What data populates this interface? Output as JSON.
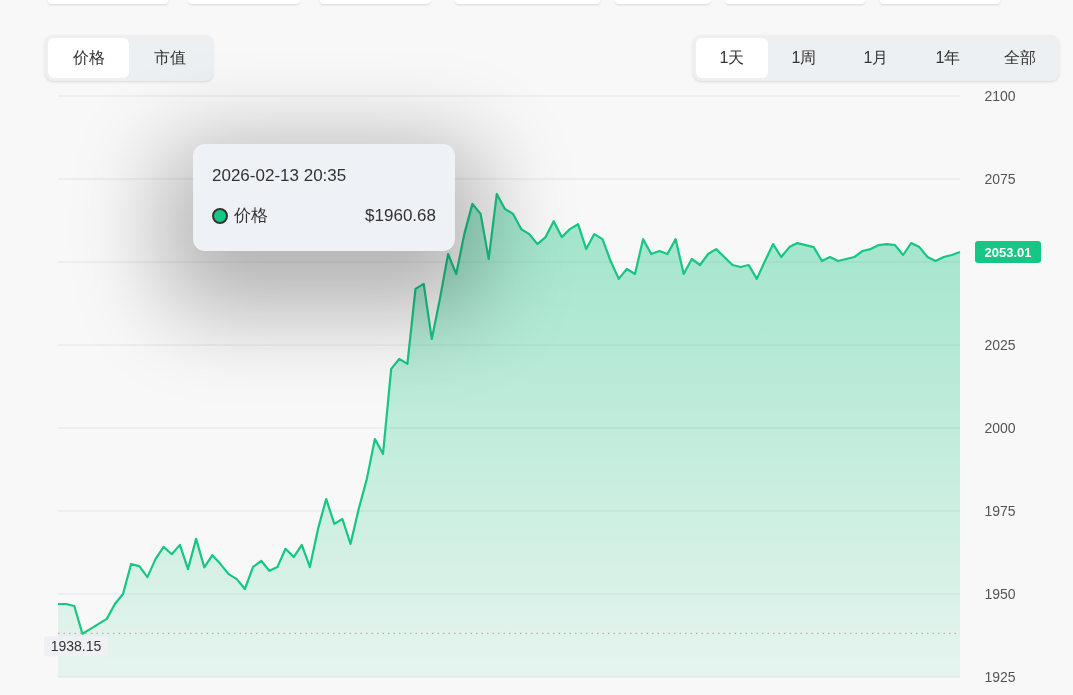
{
  "metric_tabs": [
    {
      "label": "价格",
      "selected": true
    },
    {
      "label": "市值",
      "selected": false
    }
  ],
  "range_tabs": [
    {
      "label": "1天",
      "selected": true
    },
    {
      "label": "1周",
      "selected": false
    },
    {
      "label": "1月",
      "selected": false
    },
    {
      "label": "1年",
      "selected": false
    },
    {
      "label": "全部",
      "selected": false
    }
  ],
  "chart": {
    "current_price_label": "2053.01",
    "chart_data": {
      "type": "area",
      "grid": true,
      "ylim": [
        1925,
        2100
      ],
      "yticks": [
        1925,
        1950,
        1975,
        2000,
        2025,
        2075,
        2100
      ],
      "ref_lines": [
        {
          "axis": "y",
          "value": 1938.15,
          "label": "1938.15"
        }
      ],
      "series": [
        {
          "name": "价格",
          "color": "#16c784",
          "values": [
            1947,
            1947,
            1946.4,
            1938,
            1939.5,
            1941,
            1942.5,
            1947,
            1950,
            1959,
            1958.4,
            1955.1,
            1960.5,
            1964.2,
            1962,
            1964.8,
            1957.5,
            1966.6,
            1958,
            1961.7,
            1959,
            1956,
            1954.5,
            1951.5,
            1958.1,
            1960,
            1957,
            1958.1,
            1963.6,
            1961.1,
            1964.8,
            1958.1,
            1969.6,
            1978.6,
            1971.1,
            1972.6,
            1965.1,
            1975.6,
            1984.6,
            1996.7,
            1992.2,
            2017.8,
            2020.8,
            2019.3,
            2041.9,
            2043.4,
            2026.8,
            2038.9,
            2052.4,
            2046.4,
            2058.4,
            2067.5,
            2064.5,
            2050.9,
            2070.5,
            2066,
            2064.5,
            2059.9,
            2058.4,
            2055.4,
            2057.5,
            2062.3,
            2057.5,
            2059.9,
            2061.4,
            2053.9,
            2058.4,
            2056.9,
            2050.3,
            2044.9,
            2047.9,
            2046.4,
            2056.9,
            2052.4,
            2053.3,
            2052.4,
            2056.9,
            2046.4,
            2050.9,
            2049.1,
            2052.4,
            2053.9,
            2051.5,
            2049.1,
            2048.5,
            2049.1,
            2044.9,
            2050.3,
            2055.4,
            2051.5,
            2054.5,
            2055.7,
            2055.1,
            2054.5,
            2050.3,
            2051.5,
            2050.3,
            2050.9,
            2051.5,
            2053.3,
            2053.9,
            2055.1,
            2055.4,
            2055.1,
            2052.1,
            2055.7,
            2054.5,
            2051.5,
            2050.3,
            2051.5,
            2052.1,
            2053
          ]
        }
      ]
    }
  },
  "tooltip": {
    "time": "2026-02-13 20:35",
    "value": "$1960.68",
    "color": "#16c784"
  }
}
